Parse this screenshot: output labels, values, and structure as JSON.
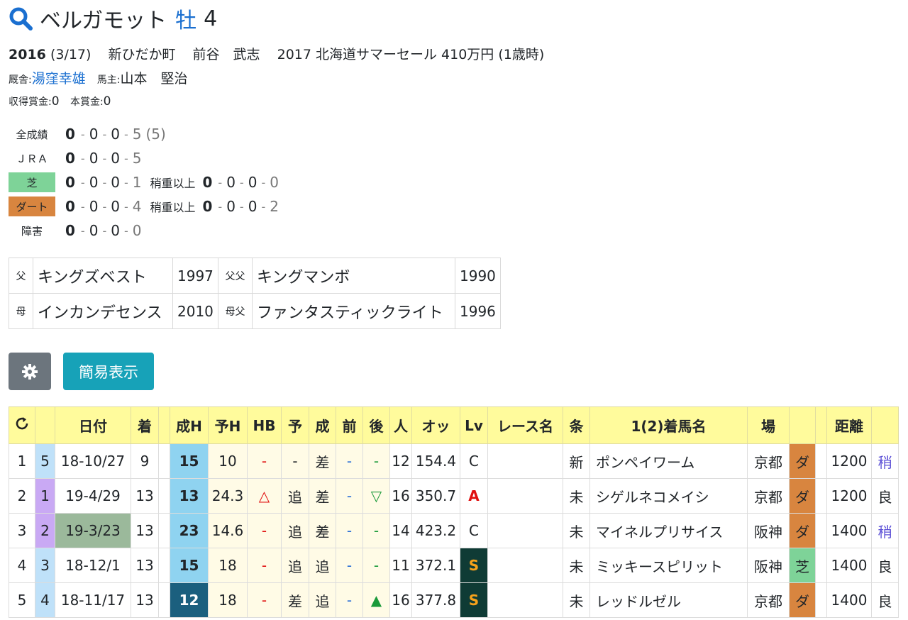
{
  "horse": {
    "name": "ベルガモット",
    "sex": "牡",
    "age": "4"
  },
  "profile": {
    "year": "2016",
    "birthday": "(3/17)",
    "breeder_area": "新ひだか町",
    "breeder": "前谷　武志",
    "sale": "2017 北海道サマーセール 410万円 (1歳時)",
    "trainer_label": "厩舎:",
    "trainer": "湯窪幸雄",
    "owner_label": "馬主:",
    "owner": "山本　堅治",
    "earn_label": "収得賞金:",
    "earn": "0",
    "prize_label": "本賞金:",
    "prize": "0"
  },
  "records": [
    {
      "label": "全成績",
      "w1": "0",
      "w2": "0",
      "w3": "0",
      "other": "5",
      "extra": "(5)"
    },
    {
      "label": "ＪＲＡ",
      "w1": "0",
      "w2": "0",
      "w3": "0",
      "other": "5"
    },
    {
      "label": "芝",
      "w1": "0",
      "w2": "0",
      "w3": "0",
      "other": "1",
      "sub_label": "稍重以上",
      "s1": "0",
      "s2": "0",
      "s3": "0",
      "s4": "0"
    },
    {
      "label": "ダート",
      "w1": "0",
      "w2": "0",
      "w3": "0",
      "other": "4",
      "sub_label": "稍重以上",
      "s1": "0",
      "s2": "0",
      "s3": "0",
      "s4": "2"
    },
    {
      "label": "障害",
      "w1": "0",
      "w2": "0",
      "w3": "0",
      "other": "0"
    }
  ],
  "pedigree": [
    {
      "k1": "父",
      "n1": "キングズベスト",
      "y1": "1997",
      "k2": "父父",
      "n2": "キングマンボ",
      "y2": "1990"
    },
    {
      "k1": "母",
      "n1": "インカンデセンス",
      "y1": "2010",
      "k2": "母父",
      "n2": "ファンタスティックライト",
      "y2": "1996"
    }
  ],
  "buttons": {
    "simple": "簡易表示",
    "settings_icon": "gear-icon",
    "reload_icon": "reload-icon"
  },
  "columns": [
    "",
    "日付",
    "着",
    "",
    "成H",
    "予H",
    "HB",
    "予",
    "成",
    "前",
    "後",
    "人",
    "オッ",
    "Lv",
    "レース名",
    "条",
    "1(2)着馬名",
    "場",
    "",
    "",
    "距離",
    ""
  ],
  "rows": [
    {
      "no": "1",
      "waku": "5",
      "date": "18-10/27",
      "rank": "9",
      "seih": "15",
      "yoh": "10",
      "hb": "-",
      "yo": "-",
      "sei": "差",
      "mae": "-",
      "ato": "-",
      "nin": "12",
      "odds": "154.4",
      "lv": "C",
      "race": "",
      "jo": "新",
      "winner": "ポンペイワーム",
      "place": "京都",
      "surf": "ダ",
      "dist": "1200",
      "baba": "稍"
    },
    {
      "no": "2",
      "waku": "1",
      "date": "19-4/29",
      "rank": "13",
      "seih": "13",
      "yoh": "24.3",
      "hb": "△",
      "yo": "追",
      "sei": "差",
      "mae": "-",
      "ato": "▽",
      "nin": "16",
      "odds": "350.7",
      "lv": "A",
      "race": "",
      "jo": "未",
      "winner": "シゲルネコメイシ",
      "place": "京都",
      "surf": "ダ",
      "dist": "1200",
      "baba": "良"
    },
    {
      "no": "3",
      "waku": "2",
      "date": "19-3/23",
      "rank": "13",
      "seih": "23",
      "yoh": "14.6",
      "hb": "-",
      "yo": "追",
      "sei": "差",
      "mae": "-",
      "ato": "-",
      "nin": "14",
      "odds": "423.2",
      "lv": "C",
      "race": "",
      "jo": "未",
      "winner": "マイネルプリサイス",
      "place": "阪神",
      "surf": "ダ",
      "dist": "1400",
      "baba": "稍"
    },
    {
      "no": "4",
      "waku": "3",
      "date": "18-12/1",
      "rank": "13",
      "seih": "15",
      "yoh": "18",
      "hb": "-",
      "yo": "追",
      "sei": "追",
      "mae": "-",
      "ato": "-",
      "nin": "11",
      "odds": "372.1",
      "lv": "S",
      "race": "",
      "jo": "未",
      "winner": "ミッキースピリット",
      "place": "阪神",
      "surf": "芝",
      "dist": "1400",
      "baba": "良"
    },
    {
      "no": "5",
      "waku": "4",
      "date": "18-11/17",
      "rank": "13",
      "seih": "12",
      "yoh": "18",
      "hb": "-",
      "yo": "差",
      "sei": "追",
      "mae": "-",
      "ato": "▲",
      "nin": "16",
      "odds": "377.8",
      "lv": "S",
      "race": "",
      "jo": "未",
      "winner": "レッドルゼル",
      "place": "京都",
      "surf": "ダ",
      "dist": "1400",
      "baba": "良"
    }
  ],
  "colors": {
    "turf": "#7ed398",
    "dirt": "#d8853f",
    "header": "#fffb9c",
    "accent": "#1a6fd0"
  }
}
